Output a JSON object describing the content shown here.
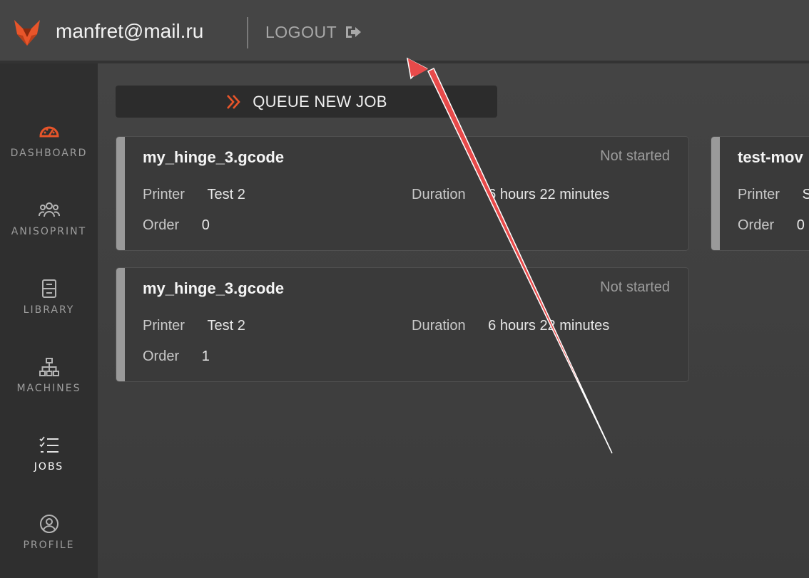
{
  "header": {
    "user_email": "manfret@mail.ru",
    "logout_label": "LOGOUT"
  },
  "sidebar": {
    "items": [
      {
        "label": "DASHBOARD",
        "icon": "speedometer-icon",
        "active": false
      },
      {
        "label": "ANISOPRINT",
        "icon": "users-group-icon",
        "active": false
      },
      {
        "label": "LIBRARY",
        "icon": "archive-box-icon",
        "active": false
      },
      {
        "label": "MACHINES",
        "icon": "sitemap-icon",
        "active": false
      },
      {
        "label": "JOBS",
        "icon": "checklist-icon",
        "active": true
      },
      {
        "label": "PROFILE",
        "icon": "user-circle-icon",
        "active": false
      }
    ]
  },
  "main": {
    "queue_button_label": "QUEUE NEW JOB",
    "jobs": [
      {
        "title": "my_hinge_3.gcode",
        "status": "Not started",
        "printer_label": "Printer",
        "printer": "Test 2",
        "duration_label": "Duration",
        "duration": "6 hours 22 minutes",
        "order_label": "Order",
        "order": "0"
      },
      {
        "title": "my_hinge_3.gcode",
        "status": "Not started",
        "printer_label": "Printer",
        "printer": "Test 2",
        "duration_label": "Duration",
        "duration": "6 hours 22 minutes",
        "order_label": "Order",
        "order": "1"
      },
      {
        "title": "test-mov",
        "printer_label": "Printer",
        "printer": "S",
        "order_label": "Order",
        "order": "0"
      }
    ]
  },
  "colors": {
    "accent": "#e8552a",
    "annotation_arrow": "#e84a4a"
  }
}
